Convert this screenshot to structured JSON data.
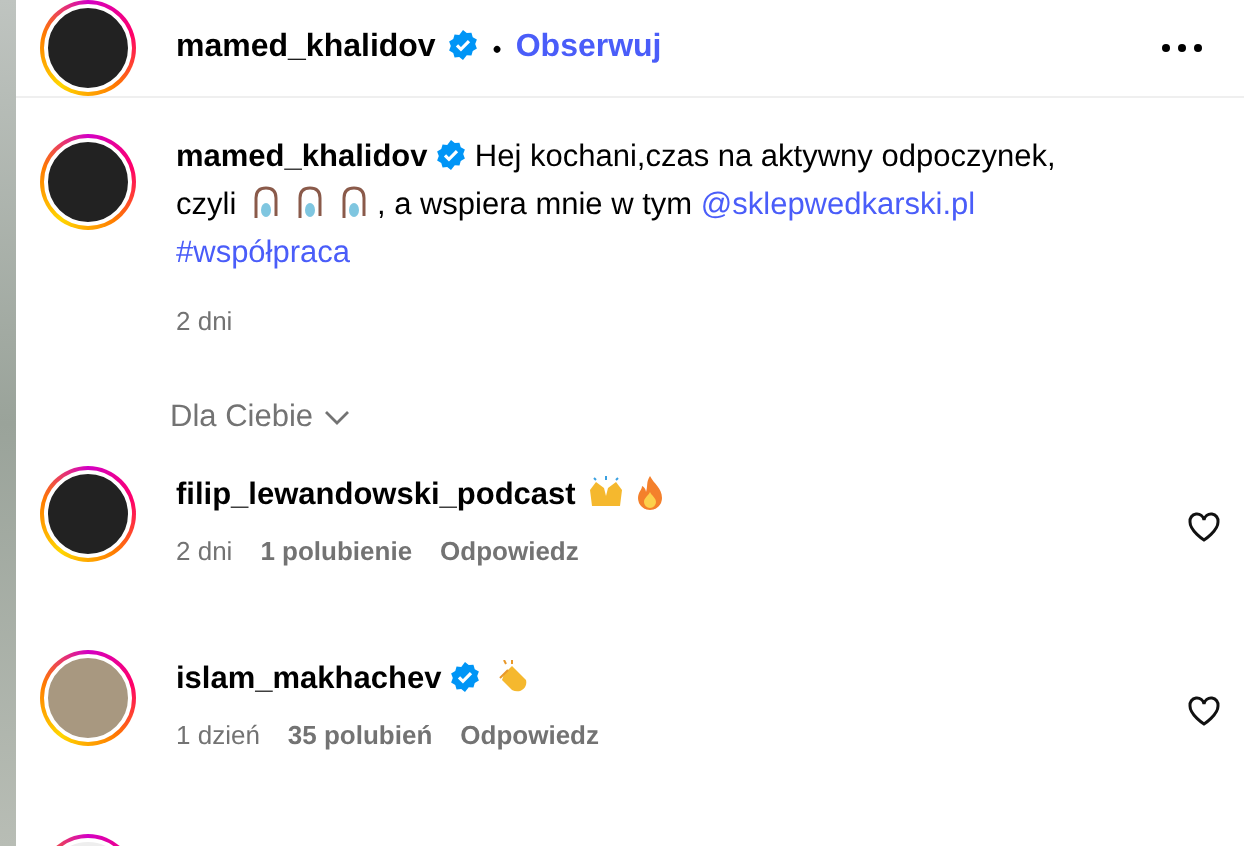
{
  "post_header": {
    "username": "mamed_khalidov",
    "verified": true,
    "separator": "•",
    "follow": "Obserwuj"
  },
  "caption": {
    "username": "mamed_khalidov",
    "verified": true,
    "segments": [
      {
        "kind": "text",
        "text": "Hej kochani,czas na aktywny odpoczynek, czyli"
      },
      {
        "kind": "fishing"
      },
      {
        "kind": "fishing"
      },
      {
        "kind": "fishing"
      },
      {
        "kind": "text",
        "text": ", a wspiera mnie w tym"
      },
      {
        "kind": "mention",
        "text": "@sklepwedkarski.pl"
      },
      {
        "kind": "hashtag",
        "text": "#współpraca"
      }
    ],
    "time": "2 dni"
  },
  "sort": {
    "label": "Dla Ciebie"
  },
  "comments": [
    {
      "kind": "comment",
      "username": "filip_lewandowski_podcast",
      "verified": false,
      "reactions": [
        {
          "kind": "raised-hands"
        },
        {
          "kind": "fire"
        }
      ],
      "time": "2 dni",
      "likes": "1 polubienie",
      "reply": "Odpowiedz"
    },
    {
      "kind": "comment",
      "username": "islam_makhachev",
      "verified": true,
      "reactions": [
        {
          "kind": "clap"
        }
      ],
      "time": "1 dzień",
      "likes": "35 polubień",
      "reply": "Odpowiedz"
    },
    {
      "kind": "cut-off"
    }
  ]
}
